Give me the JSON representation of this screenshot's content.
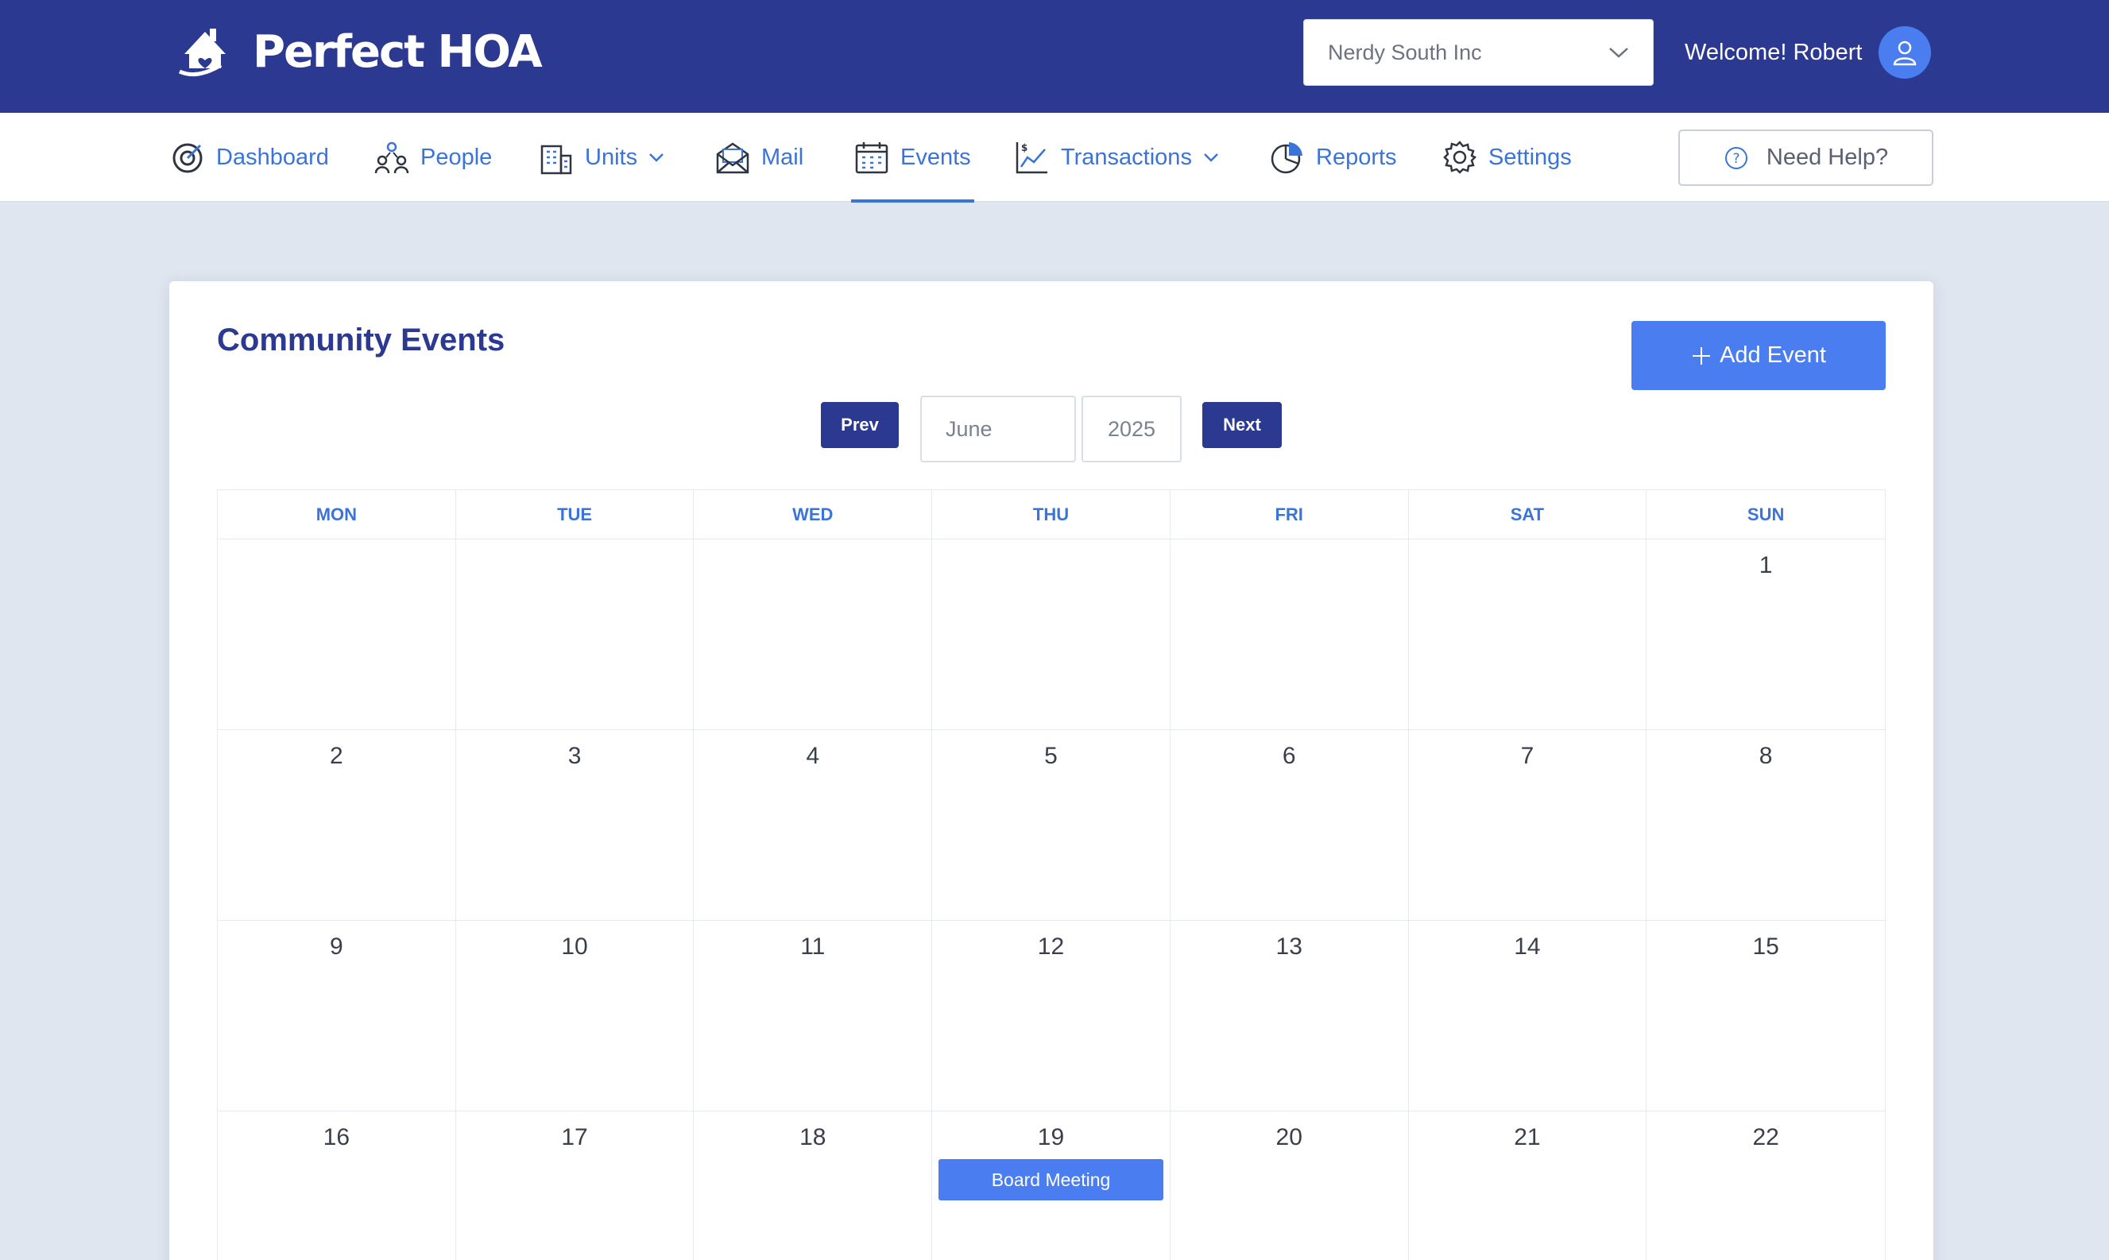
{
  "brand": {
    "name": "Perfect HOA"
  },
  "header": {
    "org_select": {
      "value": "Nerdy South Inc"
    },
    "welcome": "Welcome! Robert"
  },
  "nav": {
    "dashboard": "Dashboard",
    "people": "People",
    "units": "Units",
    "mail": "Mail",
    "events": "Events",
    "transactions": "Transactions",
    "reports": "Reports",
    "settings": "Settings",
    "active": "events",
    "help": "Need Help?"
  },
  "page": {
    "title": "Community Events",
    "add_event": "Add Event",
    "prev": "Prev",
    "next": "Next",
    "month": "June",
    "year": "2025"
  },
  "calendar": {
    "weekdays": [
      "MON",
      "TUE",
      "WED",
      "THU",
      "FRI",
      "SAT",
      "SUN"
    ],
    "weeks": [
      [
        "",
        "",
        "",
        "",
        "",
        "",
        "1"
      ],
      [
        "2",
        "3",
        "4",
        "5",
        "6",
        "7",
        "8"
      ],
      [
        "9",
        "10",
        "11",
        "12",
        "13",
        "14",
        "15"
      ],
      [
        "16",
        "17",
        "18",
        "19",
        "20",
        "21",
        "22"
      ]
    ],
    "events": [
      {
        "day": "19",
        "title": "Board Meeting"
      }
    ]
  },
  "colors": {
    "brand_navy": "#2b3990",
    "accent_blue": "#4a7ef0",
    "link_blue": "#3b74d9",
    "page_bg": "#dfe6f0"
  }
}
